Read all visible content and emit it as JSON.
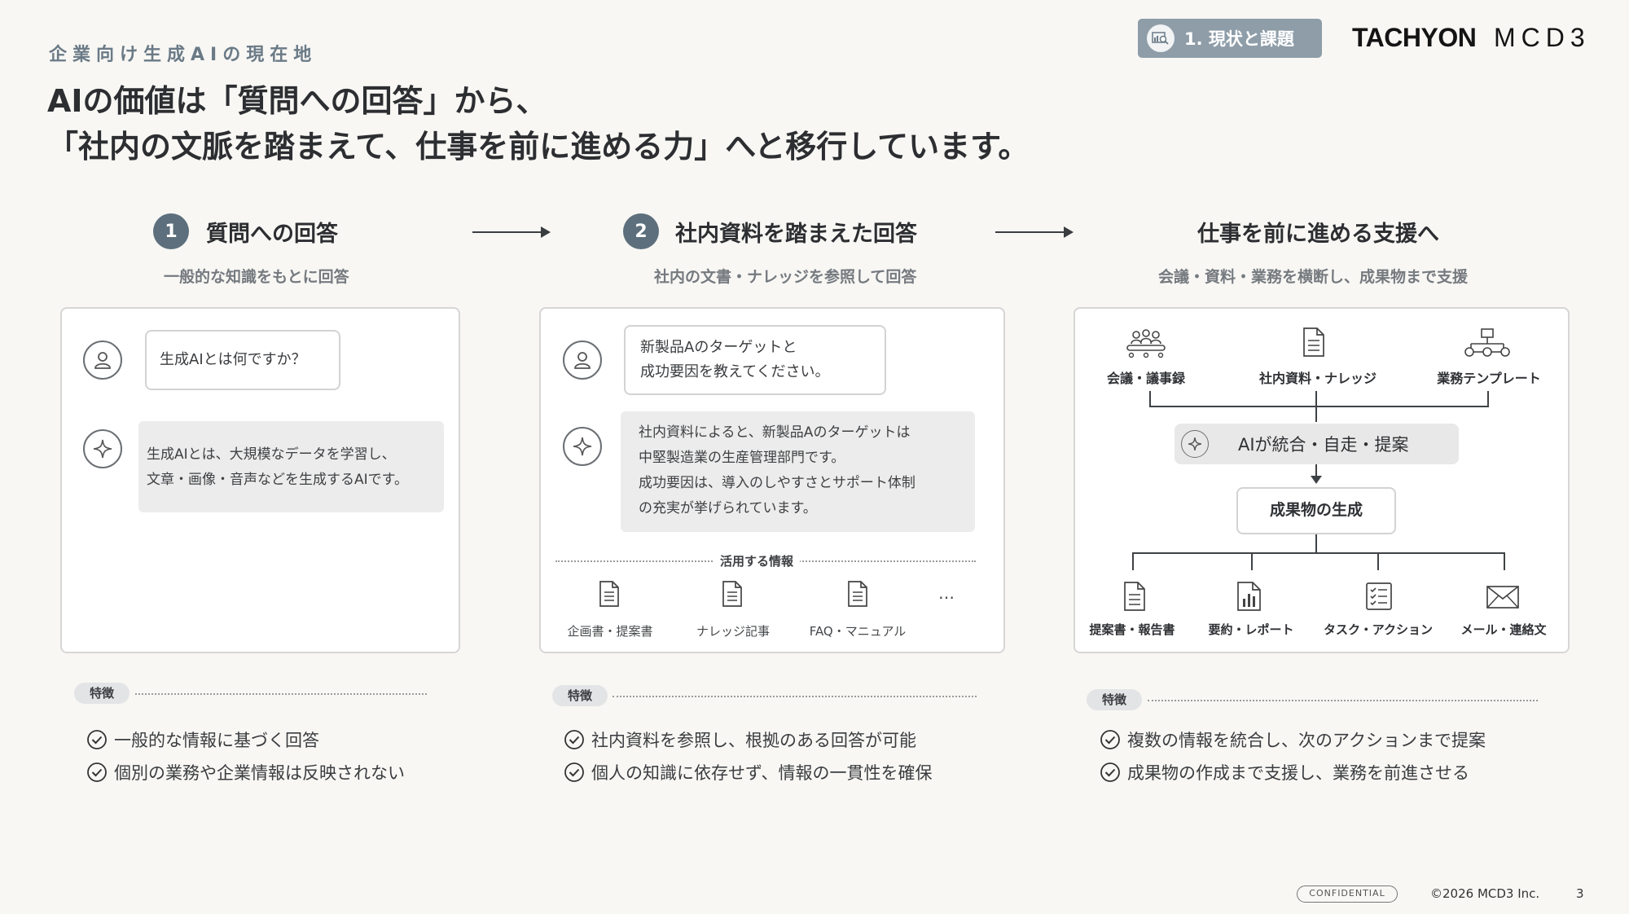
{
  "header": {
    "kicker": "企業向け生成AIの現在地",
    "title_line1": "AIの価値は「質問への回答」から、",
    "title_line2": "「社内の文脈を踏まえて、仕事を前に進める力」へと移行しています。",
    "section_label": "1. 現状と課題",
    "logo_left": "TACHYON",
    "logo_right": "MCD3"
  },
  "steps": [
    {
      "num": "1",
      "title": "質問への回答",
      "subtitle": "一般的な知識をもとに回答"
    },
    {
      "num": "2",
      "title": "社内資料を踏まえた回答",
      "subtitle": "社内の文書・ナレッジを参照して回答"
    },
    {
      "num": "",
      "title": "仕事を前に進める支援へ",
      "subtitle": "会議・資料・業務を横断し、成果物まで支援"
    }
  ],
  "card1": {
    "question": "生成AIとは何ですか？",
    "answer_line1": "生成AIとは、大規模なデータを学習し、",
    "answer_line2": "文章・画像・音声などを生成するAIです。"
  },
  "card2": {
    "question_line1": "新製品Aのターゲットと",
    "question_line2": "成功要因を教えてください。",
    "answer_line1": "社内資料によると、新製品Aのターゲットは",
    "answer_line2": "中堅製造業の生産管理部門です。",
    "answer_line3": "成功要因は、導入のしやすさとサポート体制",
    "answer_line4": "の充実が挙げられています。",
    "info_label": "活用する情報",
    "sources": [
      "企画書・提案書",
      "ナレッジ記事",
      "FAQ・マニュアル"
    ],
    "more": "…"
  },
  "card3": {
    "inputs": [
      "会議・議事録",
      "社内資料・ナレッジ",
      "業務テンプレート"
    ],
    "hub": "AIが統合・自走・提案",
    "output_box": "成果物の生成",
    "outputs": [
      "提案書・報告書",
      "要約・レポート",
      "タスク・アクション",
      "メール・連絡文"
    ]
  },
  "features": [
    {
      "tag": "特徴",
      "items": [
        "一般的な情報に基づく回答",
        "個別の業務や企業情報は反映されない"
      ]
    },
    {
      "tag": "特徴",
      "items": [
        "社内資料を参照し、根拠のある回答が可能",
        "個人の知識に依存せず、情報の一貫性を確保"
      ]
    },
    {
      "tag": "特徴",
      "items": [
        "複数の情報を統合し、次のアクションまで提案",
        "成果物の作成まで支援し、業務を前進させる"
      ]
    }
  ],
  "footer": {
    "confidential": "CONFIDENTIAL",
    "copyright": "©2026 MCD3 Inc.",
    "page": "3"
  },
  "colors": {
    "accent": "#5d6f7c",
    "chip": "#8e9da8",
    "background": "#f8f7f4"
  }
}
